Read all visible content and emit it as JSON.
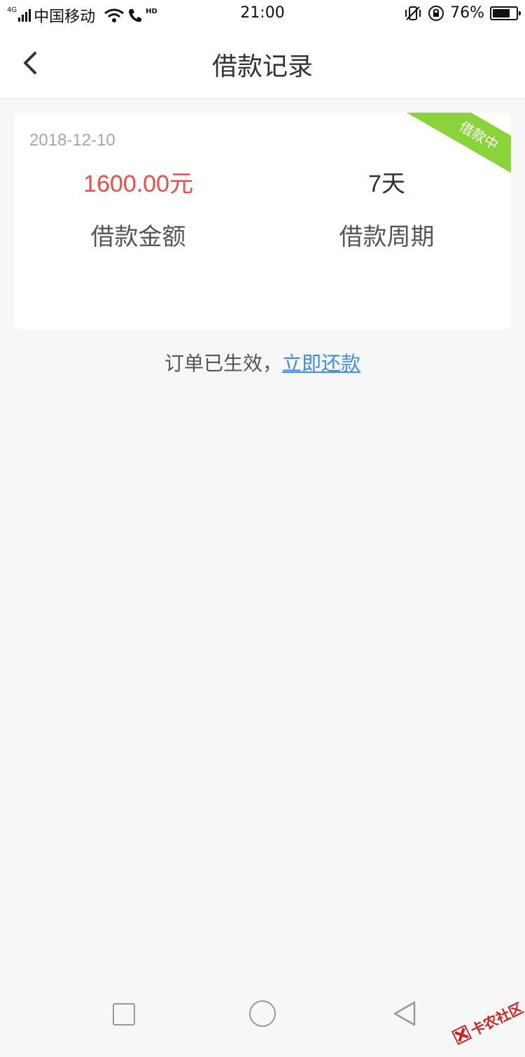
{
  "status_bar": {
    "network": "4G",
    "carrier": "中国移动",
    "hd": "HD",
    "time": "21:00",
    "battery": "76%",
    "battery_level": 0.76
  },
  "header": {
    "back_icon": "chevron-left-icon",
    "title": "借款记录"
  },
  "loan_card": {
    "date": "2018-12-10",
    "status": "借款中",
    "status_color": "#8ad33a",
    "amount": "1600.00元",
    "amount_color": "#ef4b4b",
    "amount_label": "借款金额",
    "period": "7天",
    "period_label": "借款周期"
  },
  "notice": {
    "text": "订单已生效，",
    "link_text": "立即还款",
    "link_color": "#3a8ee6"
  },
  "nav_bar": {
    "recent_icon": "square-icon",
    "home_icon": "circle-icon",
    "back_icon": "triangle-back-icon"
  },
  "watermark": {
    "text": "卡农社区"
  }
}
